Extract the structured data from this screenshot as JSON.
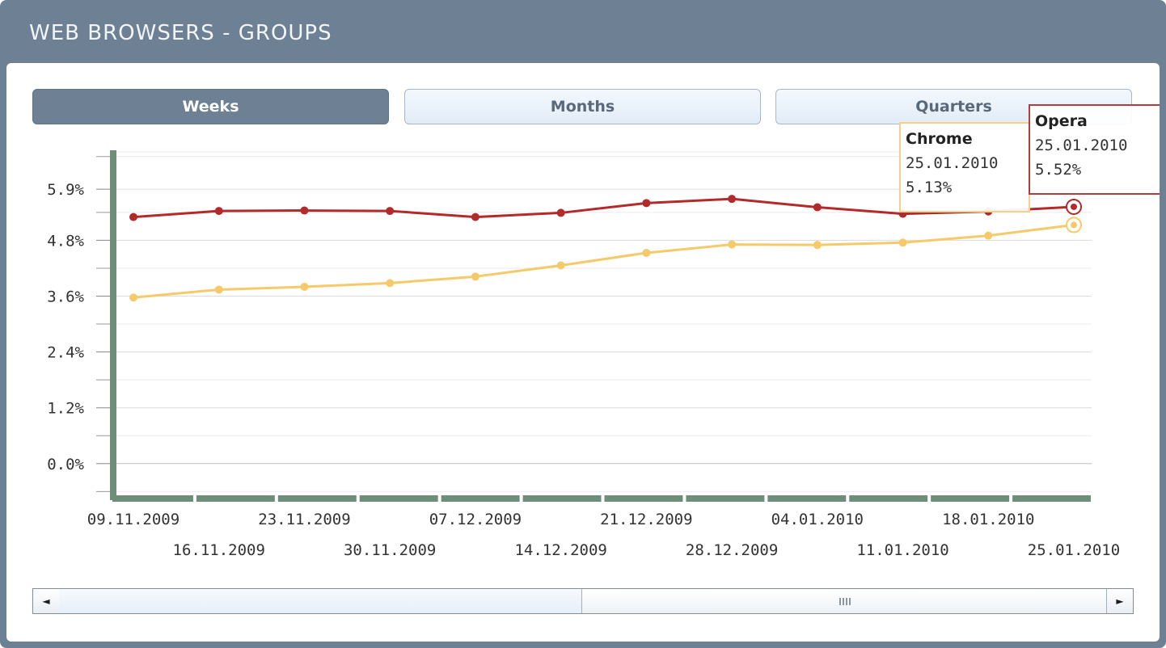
{
  "window": {
    "title": "WEB BROWSERS - GROUPS"
  },
  "tabs": [
    {
      "label": "Weeks",
      "active": true
    },
    {
      "label": "Months",
      "active": false
    },
    {
      "label": "Quarters",
      "active": false
    }
  ],
  "chart_data": {
    "type": "line",
    "x": [
      "09.11.2009",
      "16.11.2009",
      "23.11.2009",
      "30.11.2009",
      "07.12.2009",
      "14.12.2009",
      "21.12.2009",
      "28.12.2009",
      "04.01.2010",
      "11.01.2010",
      "18.01.2010",
      "25.01.2010"
    ],
    "y_ticks": [
      "0.0%",
      "1.2%",
      "2.4%",
      "3.6%",
      "4.8%",
      "5.9%"
    ],
    "ylim": [
      -0.75,
      6.7
    ],
    "series": [
      {
        "name": "Opera",
        "color": "#b32a2a",
        "values": [
          5.3,
          5.43,
          5.44,
          5.43,
          5.3,
          5.39,
          5.6,
          5.69,
          5.51,
          5.37,
          5.42,
          5.52
        ]
      },
      {
        "name": "Chrome",
        "color": "#f6c96a",
        "values": [
          3.57,
          3.74,
          3.8,
          3.88,
          4.02,
          4.26,
          4.53,
          4.71,
          4.7,
          4.75,
          4.9,
          5.13
        ]
      }
    ],
    "grid": true,
    "highlight_index": 11
  },
  "tooltips": {
    "chrome": {
      "name": "Chrome",
      "date": "25.01.2010",
      "value": "5.13%"
    },
    "opera": {
      "name": "Opera",
      "date": "25.01.2010",
      "value": "5.52%"
    }
  },
  "scrollbar": {
    "left_arrow": "◄",
    "right_arrow": "►"
  }
}
